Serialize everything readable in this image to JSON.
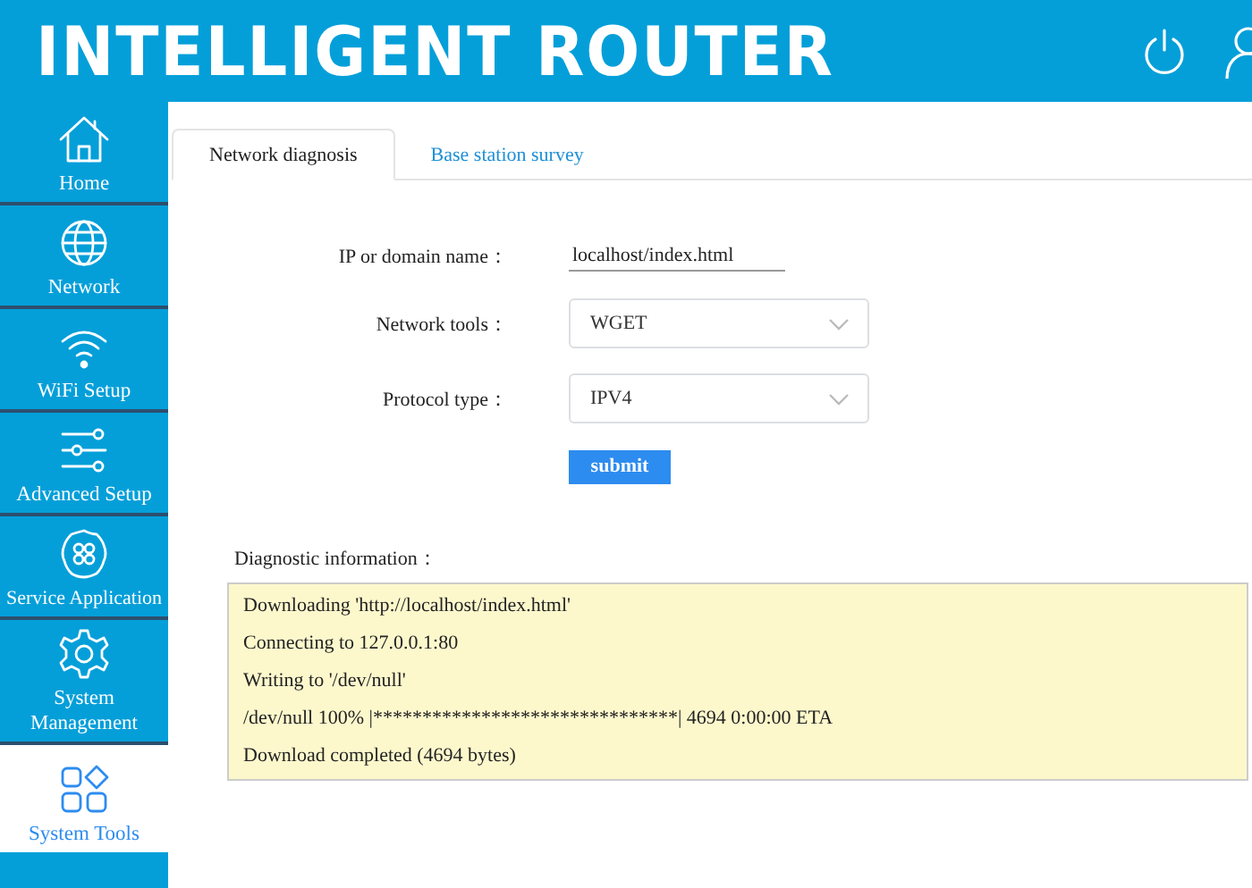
{
  "header": {
    "title": "INTELLIGENT ROUTER"
  },
  "sidebar": {
    "items": [
      {
        "label": "Home",
        "selected": false
      },
      {
        "label": "Network",
        "selected": false
      },
      {
        "label": "WiFi Setup",
        "selected": false
      },
      {
        "label": "Advanced Setup",
        "selected": false
      },
      {
        "label": "Service Application",
        "selected": false
      },
      {
        "label": "System Management",
        "selected": false
      },
      {
        "label": "System Tools",
        "selected": true
      }
    ]
  },
  "tabs": [
    {
      "label": "Network diagnosis",
      "selected": true
    },
    {
      "label": "Base station survey",
      "selected": false
    }
  ],
  "form": {
    "fields": [
      {
        "kind": "text",
        "label": "IP or domain name：",
        "value": "localhost/index.html"
      },
      {
        "kind": "select",
        "label": "Network tools：",
        "value": "WGET"
      },
      {
        "kind": "select",
        "label": "Protocol type：",
        "value": "IPV4"
      }
    ],
    "submit": "submit"
  },
  "diagnostic": {
    "label": "Diagnostic information：",
    "lines": [
      "Downloading 'http://localhost/index.html'",
      "Connecting to 127.0.0.1:80",
      "Writing to '/dev/null'",
      "/dev/null 100% |*******************************| 4694 0:00:00 ETA",
      "Download completed (4694 bytes)"
    ]
  }
}
